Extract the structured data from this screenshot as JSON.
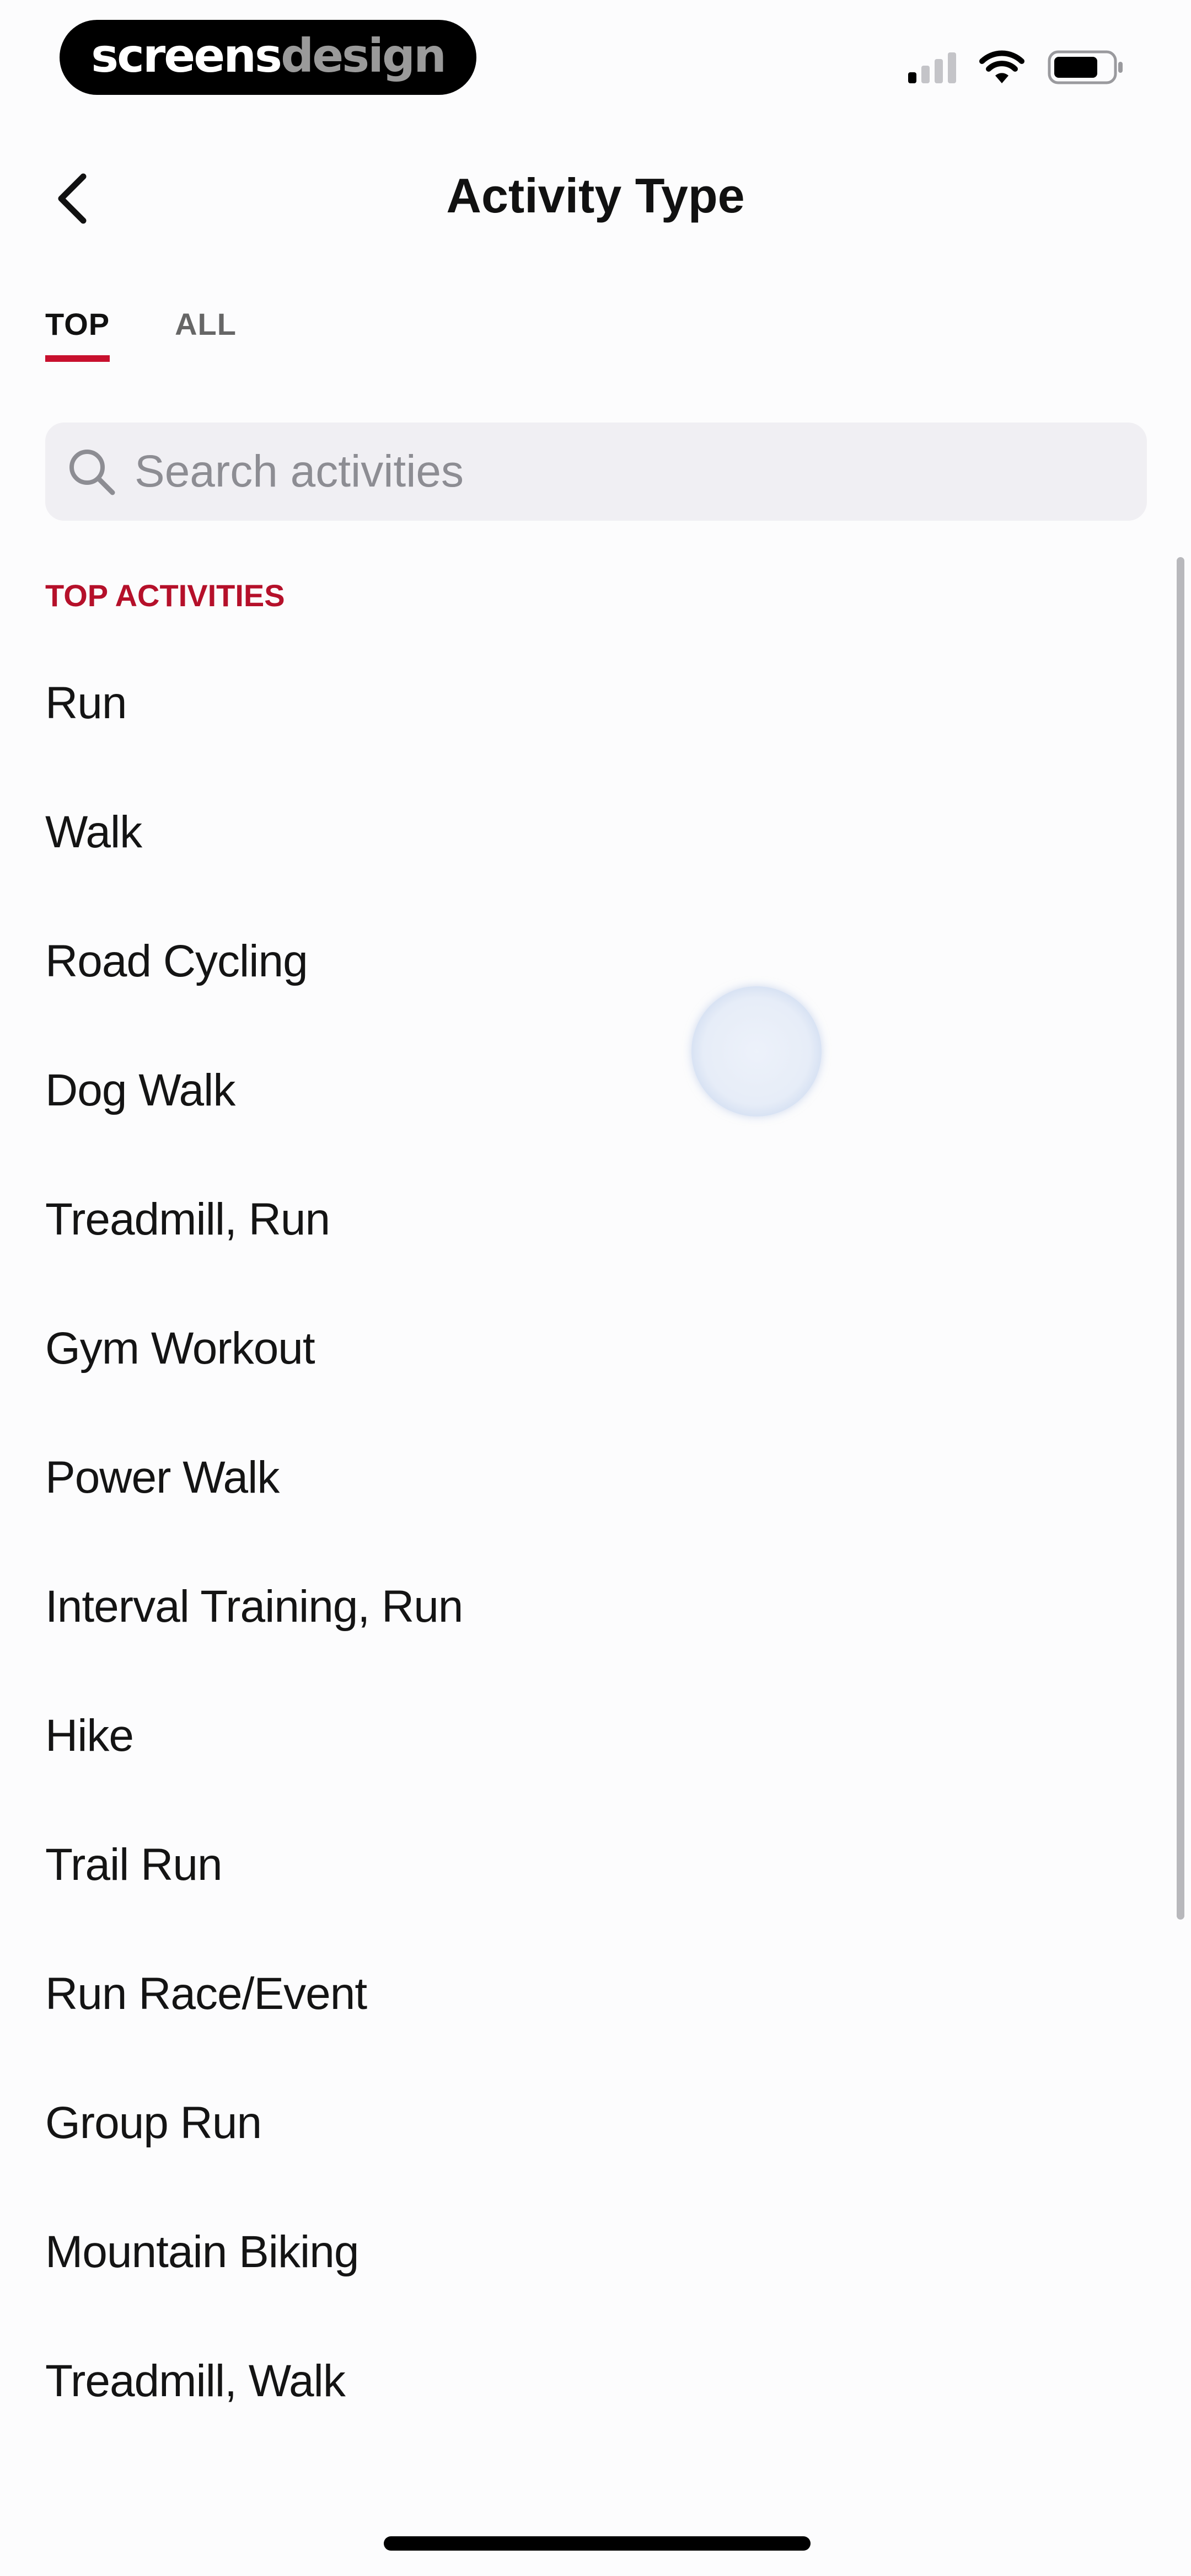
{
  "status_bar": {
    "brand": {
      "part1": "screens",
      "part2": "design"
    },
    "signal_icon": "cellular-signal-icon",
    "wifi_icon": "wifi-icon",
    "battery_icon": "battery-icon",
    "signal_bars_active": 1,
    "signal_bars_total": 4,
    "battery_level": 0.7
  },
  "header": {
    "title": "Activity Type",
    "back_icon": "chevron-left-icon"
  },
  "tabs": [
    {
      "label": "TOP",
      "active": true
    },
    {
      "label": "ALL",
      "active": false
    }
  ],
  "search": {
    "placeholder": "Search activities",
    "value": "",
    "icon": "search-icon"
  },
  "section": {
    "title": "TOP ACTIVITIES"
  },
  "activities": [
    {
      "label": "Run"
    },
    {
      "label": "Walk"
    },
    {
      "label": "Road Cycling"
    },
    {
      "label": "Dog Walk"
    },
    {
      "label": "Treadmill, Run"
    },
    {
      "label": "Gym Workout"
    },
    {
      "label": "Power Walk"
    },
    {
      "label": "Interval Training, Run"
    },
    {
      "label": "Hike"
    },
    {
      "label": "Trail Run"
    },
    {
      "label": "Run Race/Event"
    },
    {
      "label": "Group Run"
    },
    {
      "label": "Mountain Biking"
    },
    {
      "label": "Treadmill, Walk"
    }
  ],
  "colors": {
    "accent": "#c8102e",
    "section_title": "#b5102a",
    "search_background": "#f0eff3",
    "text": "#111111",
    "placeholder": "#8d8d93"
  }
}
